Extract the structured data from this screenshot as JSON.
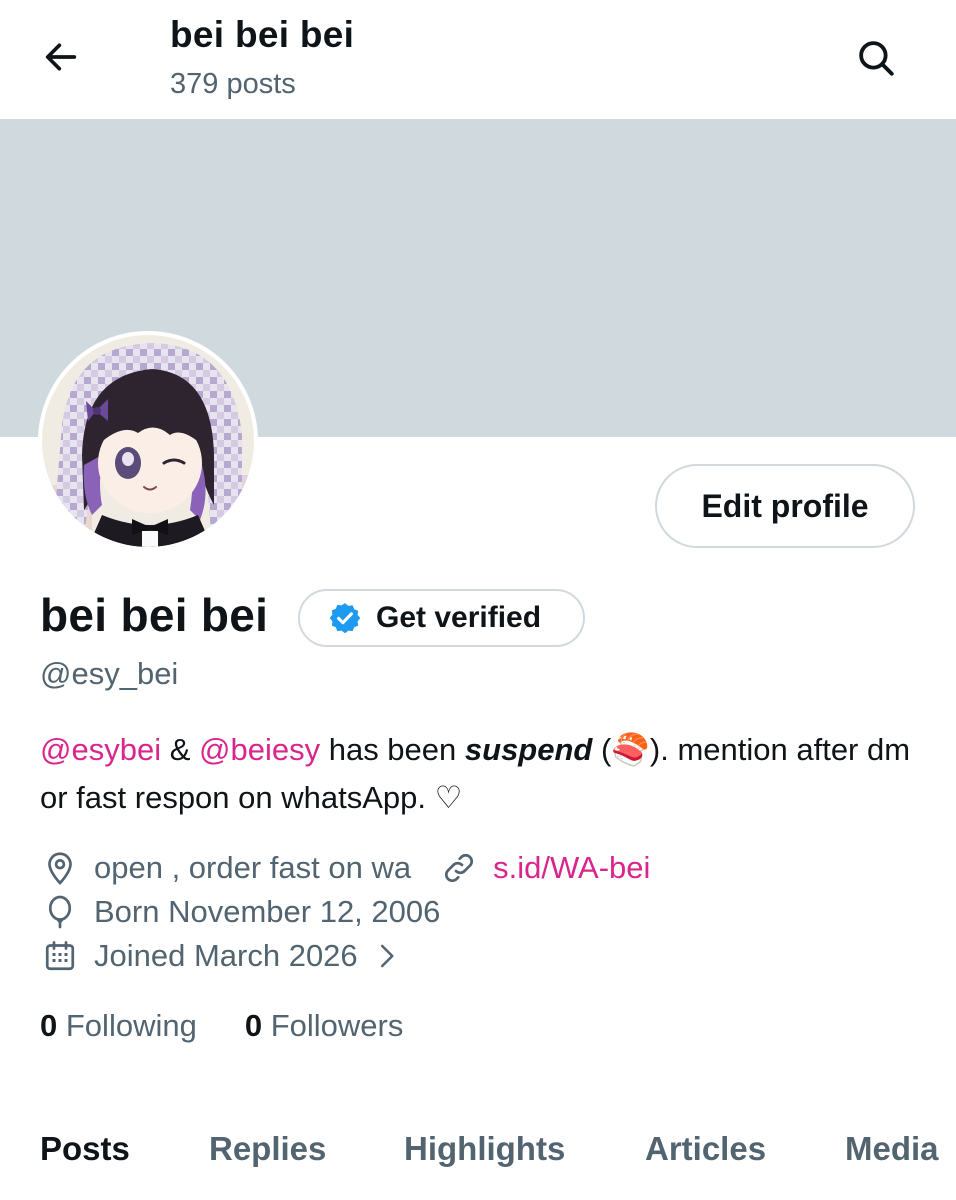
{
  "header": {
    "title": "bei bei bei",
    "post_count": "379 posts"
  },
  "profile": {
    "edit_label": "Edit profile",
    "display_name": "bei bei bei",
    "verify_label": "Get verified",
    "handle": "@esy_bei",
    "bio": {
      "mention_1": "@esybei",
      "amp": " & ",
      "mention_2": "@beiesy",
      "text_1": " has been ",
      "emphasis": "suspend",
      "paren_open": " (",
      "emoji": "🍣",
      "text_2": "). mention after dm or fast respon on whatsApp. ",
      "heart": "♡"
    },
    "location": "open , order fast on wa",
    "link": "s.id/WA-bei",
    "birthday": "Born November 12, 2006",
    "joined": "Joined March 2026",
    "following_count": "0",
    "following_label": "Following",
    "followers_count": "0",
    "followers_label": "Followers"
  },
  "tabs": [
    {
      "label": "Posts",
      "active": true
    },
    {
      "label": "Replies",
      "active": false
    },
    {
      "label": "Highlights",
      "active": false
    },
    {
      "label": "Articles",
      "active": false
    },
    {
      "label": "Media",
      "active": false
    }
  ],
  "colors": {
    "accent_pink": "#d9268d",
    "verified_blue": "#1d9bf0",
    "banner": "#cfd9de",
    "secondary_text": "#536471"
  },
  "icons": {
    "back": "arrow-left-icon",
    "search": "search-icon",
    "verified": "verified-badge-icon",
    "location": "location-pin-icon",
    "link": "link-icon",
    "birthday": "balloon-icon",
    "calendar": "calendar-icon",
    "chevron": "chevron-right-icon"
  }
}
